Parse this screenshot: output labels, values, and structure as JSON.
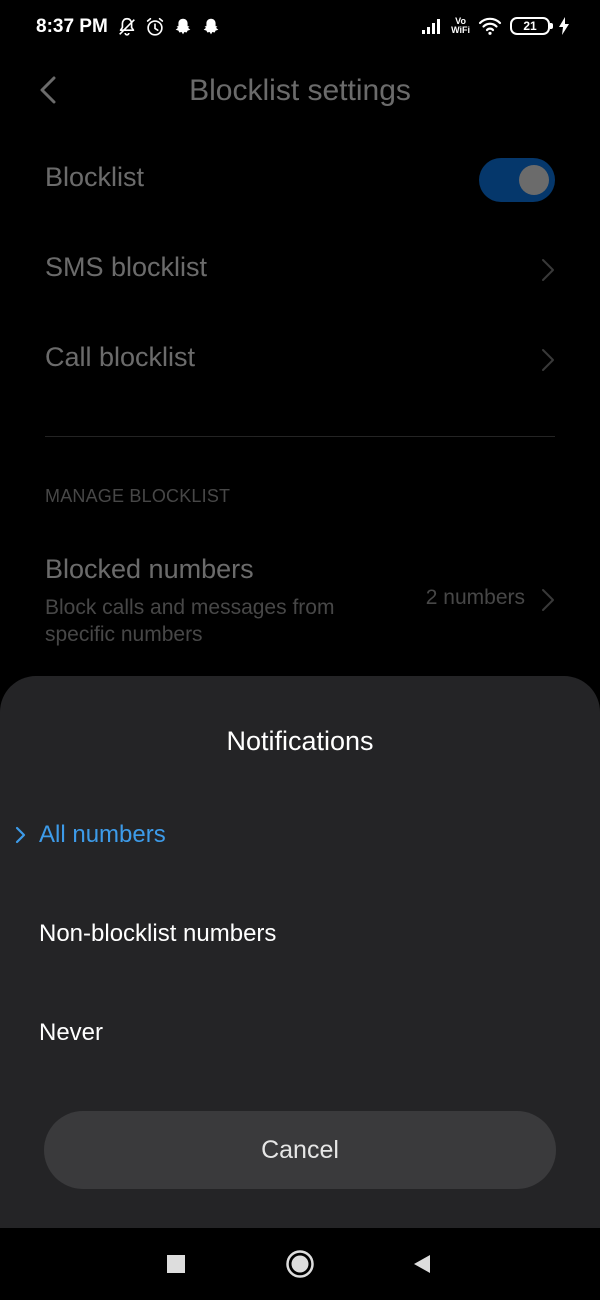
{
  "status_bar": {
    "time": "8:37 PM",
    "battery_level": "21",
    "vowifi_top": "Vo",
    "vowifi_bottom": "WiFi",
    "icons": [
      "notifications-off-icon",
      "alarm-icon",
      "snapchat-icon",
      "snapchat-icon",
      "signal-icon",
      "vowifi-icon",
      "wifi-icon",
      "battery-icon",
      "charging-icon"
    ]
  },
  "header": {
    "title": "Blocklist settings",
    "back_icon": "chevron-left-icon"
  },
  "settings": {
    "blocklist_label": "Blocklist",
    "blocklist_enabled": true,
    "sms_label": "SMS blocklist",
    "call_label": "Call blocklist"
  },
  "manage": {
    "section_header": "MANAGE BLOCKLIST",
    "blocked_title": "Blocked numbers",
    "blocked_desc": "Block calls and messages from specific numbers",
    "blocked_count": "2 numbers"
  },
  "dialog": {
    "title": "Notifications",
    "options": [
      {
        "label": "All numbers",
        "selected": true
      },
      {
        "label": "Non-blocklist numbers",
        "selected": false
      },
      {
        "label": "Never",
        "selected": false
      }
    ],
    "cancel_label": "Cancel"
  },
  "colors": {
    "accent": "#3d9be9",
    "toggle": "#0d84ff",
    "sheet": "#242426",
    "button": "#3a3a3c"
  },
  "navbar": {
    "icons": [
      "recents-icon",
      "home-icon",
      "back-icon"
    ]
  }
}
